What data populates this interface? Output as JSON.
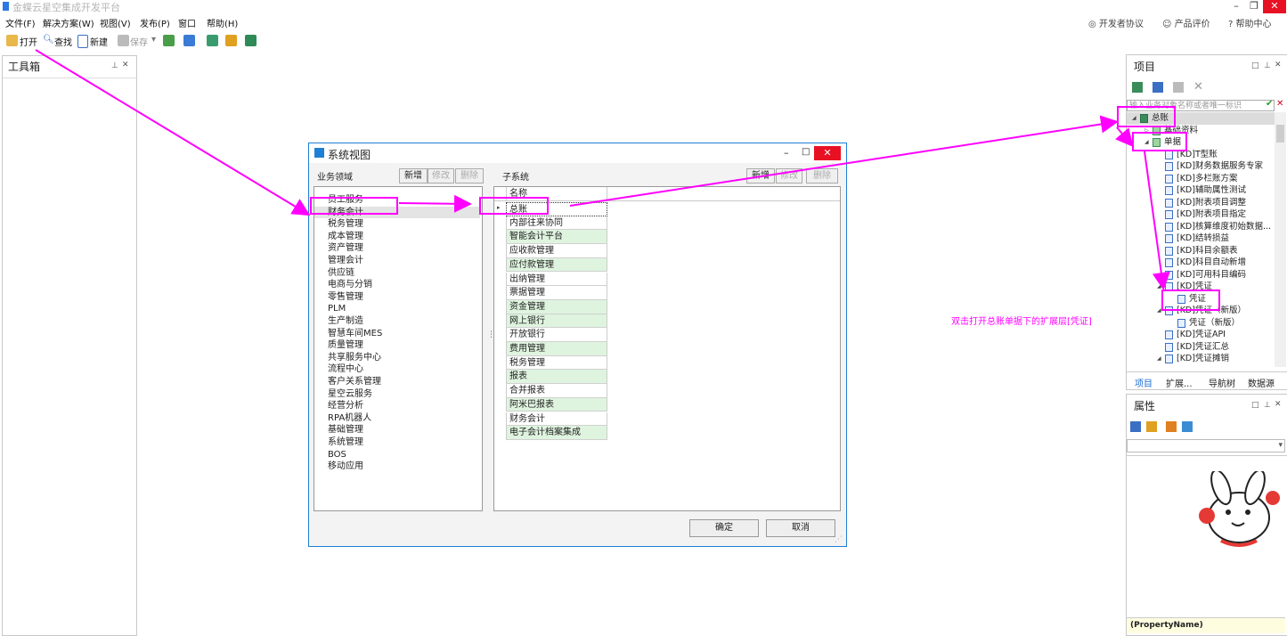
{
  "app": {
    "title": "金蝶云星空集成开发平台"
  },
  "menu": [
    "文件(F)",
    "解决方案(W)",
    "视图(V)",
    "发布(P)",
    "窗口",
    "帮助(H)"
  ],
  "header_links": [
    "开发者协议",
    "产品评价",
    "帮助中心"
  ],
  "toolbar": {
    "open": "打开",
    "find": "查找",
    "new": "新建",
    "save": "保存"
  },
  "toolbox": {
    "title": "工具箱"
  },
  "project": {
    "title": "项目",
    "search_placeholder": "输入业务对象名称或者唯一标识",
    "tree": [
      {
        "label": "总账",
        "level": 0,
        "toggle": "◢"
      },
      {
        "label": "基础资料",
        "level": 1,
        "toggle": "▷"
      },
      {
        "label": "单据",
        "level": 1,
        "toggle": "◢"
      },
      {
        "label": "[KD]T型账",
        "level": 2
      },
      {
        "label": "[KD]财务数据服务专家",
        "level": 2
      },
      {
        "label": "[KD]多栏账方案",
        "level": 2
      },
      {
        "label": "[KD]辅助属性测试",
        "level": 2
      },
      {
        "label": "[KD]附表项目调整",
        "level": 2
      },
      {
        "label": "[KD]附表项目指定",
        "level": 2
      },
      {
        "label": "[KD]核算维度初始数据...",
        "level": 2
      },
      {
        "label": "[KD]结转损益",
        "level": 2
      },
      {
        "label": "[KD]科目余额表",
        "level": 2
      },
      {
        "label": "[KD]科目自动新增",
        "level": 2
      },
      {
        "label": "[KD]可用科目编码",
        "level": 2
      },
      {
        "label": "[KD]凭证",
        "level": 2,
        "toggle": "◢"
      },
      {
        "label": "凭证",
        "level": 3
      },
      {
        "label": "[KD]凭证（新版）",
        "level": 2,
        "toggle": "◢"
      },
      {
        "label": "凭证（新版）",
        "level": 3
      },
      {
        "label": "[KD]凭证API",
        "level": 2
      },
      {
        "label": "[KD]凭证汇总",
        "level": 2
      },
      {
        "label": "[KD]凭证摊销",
        "level": 2,
        "toggle": "◢"
      }
    ],
    "tabs": [
      "项目",
      "扩展...",
      "导航树",
      "数据源"
    ]
  },
  "properties": {
    "title": "属性",
    "footer": "(PropertyName)"
  },
  "dialog": {
    "title": "系统视图",
    "domain_label": "业务领域",
    "subsystem_label": "子系统",
    "btn_new": "新增",
    "btn_edit": "修改",
    "btn_delete": "删除",
    "domains": [
      "员工服务",
      "财务会计",
      "税务管理",
      "成本管理",
      "资产管理",
      "管理会计",
      "供应链",
      "电商与分销",
      "零售管理",
      "PLM",
      "生产制造",
      "智慧车间MES",
      "质量管理",
      "共享服务中心",
      "流程中心",
      "客户关系管理",
      "星空云服务",
      "经营分析",
      "RPA机器人",
      "基础管理",
      "系统管理",
      "BOS",
      "移动应用"
    ],
    "grid_header": "名称",
    "subsystems": [
      "总账",
      "内部往来协同",
      "智能会计平台",
      "应收款管理",
      "应付款管理",
      "出纳管理",
      "票据管理",
      "资金管理",
      "网上银行",
      "开放银行",
      "费用管理",
      "税务管理",
      "报表",
      "合并报表",
      "阿米巴报表",
      "财务会计",
      "电子会计档案集成"
    ],
    "ok": "确定",
    "cancel": "取消"
  },
  "annotation": "双击打开总账单据下的扩展层[凭证]"
}
